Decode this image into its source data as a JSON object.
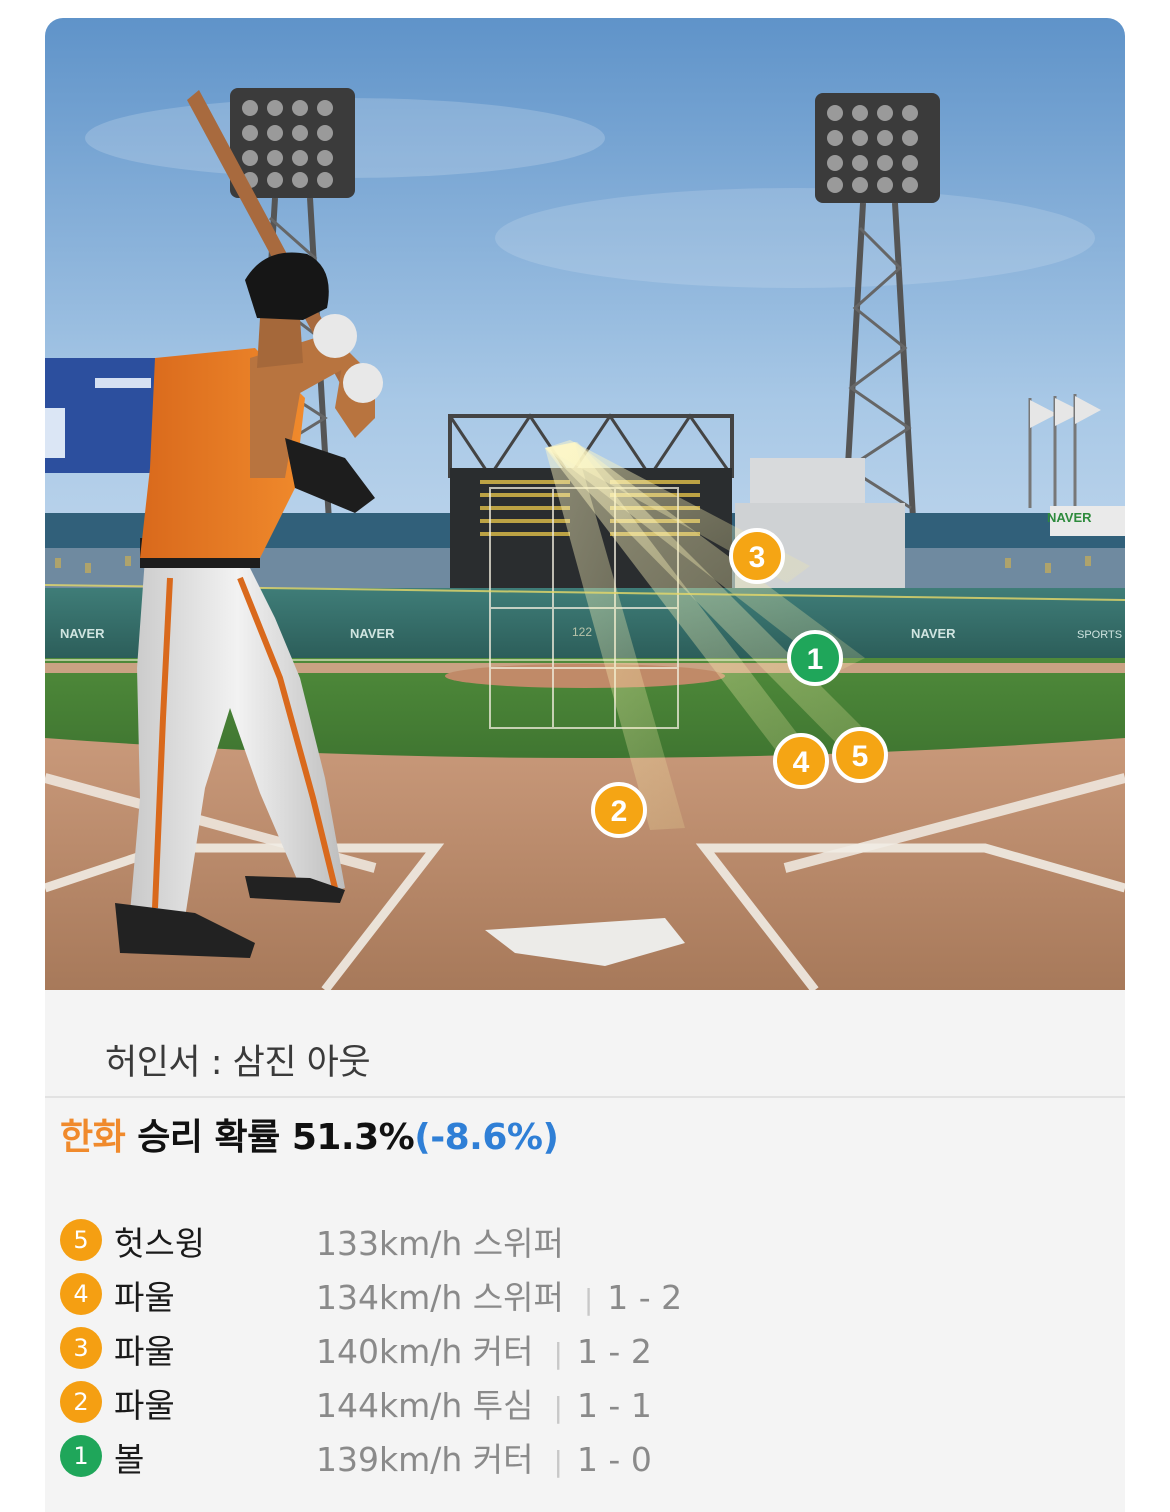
{
  "scene": {
    "ad_text": "NAVER",
    "ad_sports": "SPORTS",
    "scoreboard_speed": "122",
    "pitch_markers": [
      "3",
      "1",
      "4",
      "5",
      "2"
    ],
    "colors": {
      "orange_marker": "#f5a514",
      "green_marker": "#1fa65a",
      "team_accent": "#f08a2c"
    }
  },
  "result": {
    "text": "허인서 : 삼진 아웃"
  },
  "win_probability": {
    "team": "한화",
    "label": " 승리 확률 51.3%",
    "delta": "(-8.6%)"
  },
  "pitches": [
    {
      "num": "5",
      "result": "헛스윙",
      "speed_type": "133km/h  스위퍼",
      "count": "",
      "badge": "orange"
    },
    {
      "num": "4",
      "result": "파울",
      "speed_type": "134km/h  스위퍼",
      "count": "1 - 2",
      "badge": "orange"
    },
    {
      "num": "3",
      "result": "파울",
      "speed_type": "140km/h  커터",
      "count": "1 - 2",
      "badge": "orange"
    },
    {
      "num": "2",
      "result": "파울",
      "speed_type": "144km/h  투심",
      "count": "1 - 1",
      "badge": "orange"
    },
    {
      "num": "1",
      "result": "볼",
      "speed_type": "139km/h  커터",
      "count": "1 - 0",
      "badge": "green"
    }
  ]
}
